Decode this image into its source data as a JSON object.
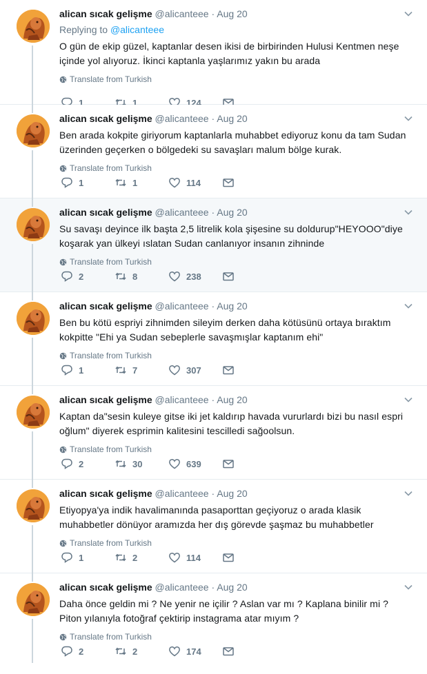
{
  "tweets": [
    {
      "name": "alican sıcak gelişme",
      "handle": "@alicanteee",
      "time": "Aug 20",
      "replying_prefix": "Replying to",
      "replying_to": "@alicanteee",
      "text": "O gün de ekip güzel, kaptanlar desen ikisi de birbirinden Hulusi Kentmen neşe içinde yol alıyoruz. İkinci kaptanla yaşlarımız yakın bu arada",
      "translate": "Translate from Turkish",
      "replies": "1",
      "retweets": "1",
      "likes": "124"
    },
    {
      "name": "alican sıcak gelişme",
      "handle": "@alicanteee",
      "time": "Aug 20",
      "text": "Ben arada kokpite giriyorum kaptanlarla muhabbet ediyoruz konu da tam Sudan üzerinden geçerken o bölgedeki su savaşları malum bölge kurak.",
      "translate": "Translate from Turkish",
      "replies": "1",
      "retweets": "1",
      "likes": "114"
    },
    {
      "name": "alican sıcak gelişme",
      "handle": "@alicanteee",
      "time": "Aug 20",
      "text": "Su savaşı deyince ilk başta 2,5 litrelik kola şişesine su doldurup\"HEYOOO\"diye koşarak yan ülkeyi ıslatan Sudan canlanıyor insanın zihninde",
      "translate": "Translate from Turkish",
      "replies": "2",
      "retweets": "8",
      "likes": "238"
    },
    {
      "name": "alican sıcak gelişme",
      "handle": "@alicanteee",
      "time": "Aug 20",
      "text": "Ben bu kötü espriyi zihnimden sileyim derken daha kötüsünü ortaya bıraktım kokpitte \"Ehi ya Sudan sebeplerle savaşmışlar kaptanım ehi\"",
      "translate": "Translate from Turkish",
      "replies": "1",
      "retweets": "7",
      "likes": "307"
    },
    {
      "name": "alican sıcak gelişme",
      "handle": "@alicanteee",
      "time": "Aug 20",
      "text": "Kaptan da\"sesin kuleye gitse iki jet kaldırıp havada vururlardı bizi bu nasıl espri oğlum\" diyerek esprimin kalitesini tescilledi sağoolsun.",
      "translate": "Translate from Turkish",
      "replies": "2",
      "retweets": "30",
      "likes": "639"
    },
    {
      "name": "alican sıcak gelişme",
      "handle": "@alicanteee",
      "time": "Aug 20",
      "text": "Etiyopya'ya indik havalimanında pasaporttan geçiyoruz o arada klasik muhabbetler dönüyor aramızda her dış görevde şaşmaz bu muhabbetler",
      "translate": "Translate from Turkish",
      "replies": "1",
      "retweets": "2",
      "likes": "114"
    },
    {
      "name": "alican sıcak gelişme",
      "handle": "@alicanteee",
      "time": "Aug 20",
      "text": "Daha önce geldin mi ? Ne yenir ne içilir ? Aslan var mı ? Kaplana binilir mi ? Piton yılanıyla fotoğraf çektirip instagrama atar mıyım ?",
      "translate": "Translate from Turkish",
      "replies": "2",
      "retweets": "2",
      "likes": "174"
    }
  ],
  "colors": {
    "accent": "#1da1f2",
    "muted": "#657786",
    "thread_line": "#ccd6dd",
    "highlight_bg": "#f5f8fa"
  },
  "icons": [
    "chevron-down-icon",
    "globe-icon",
    "reply-icon",
    "retweet-icon",
    "like-icon",
    "message-icon"
  ]
}
